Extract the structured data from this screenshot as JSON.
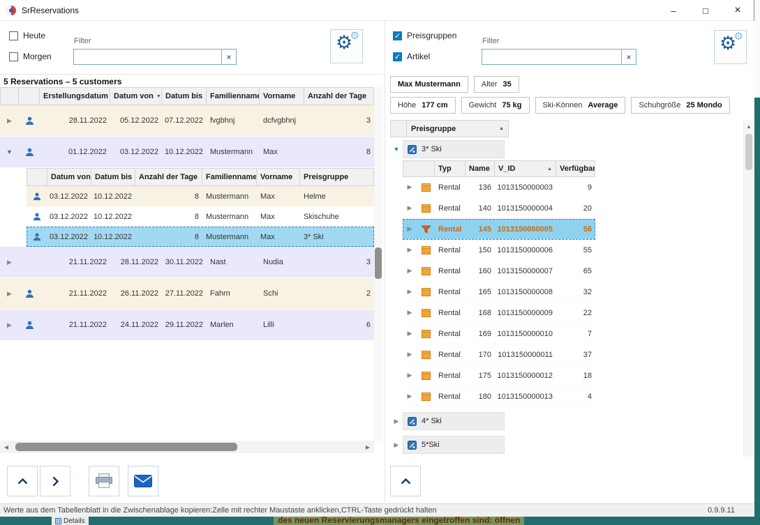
{
  "window": {
    "title": "SrReservations",
    "minimize": "–",
    "maximize": "□",
    "close": "×"
  },
  "icons": {
    "gear": "⚙",
    "clear": "×",
    "sort_up": "▲",
    "sort_down": "▼",
    "collapsed": "▶",
    "expanded": "▼",
    "scroll_left": "◀",
    "scroll_right": "▶",
    "scroll_up": "▲"
  },
  "left": {
    "today_label": "Heute",
    "tomorrow_label": "Morgen",
    "filter_label": "Filter",
    "filter_value": "",
    "summary": "5 Reservations – 5 customers",
    "columns": [
      "Erstellungsdatum",
      "Datum von",
      "Datum bis",
      "Familienname",
      "Vorname",
      "Anzahl der Tage"
    ],
    "rows": [
      {
        "erst": "28.11.2022",
        "von": "05.12.2022",
        "bis": "07.12.2022",
        "fam": "fvgbhnj",
        "vor": "dcfvgbhnj",
        "tage": "3"
      },
      {
        "erst": "01.12.2022",
        "von": "03.12.2022",
        "bis": "10.12.2022",
        "fam": "Mustermann",
        "vor": "Max",
        "tage": "8"
      },
      {
        "erst": "21.11.2022",
        "von": "28.11.2022",
        "bis": "30.11.2022",
        "fam": "Nast",
        "vor": "Nudia",
        "tage": "3"
      },
      {
        "erst": "21.11.2022",
        "von": "26.11.2022",
        "bis": "27.11.2022",
        "fam": "Fahrn",
        "vor": "Schi",
        "tage": "2"
      },
      {
        "erst": "21.11.2022",
        "von": "24.11.2022",
        "bis": "29.11.2022",
        "fam": "Marlen",
        "vor": "Lilli",
        "tage": "6"
      }
    ],
    "sub": {
      "columns": [
        "Datum von",
        "Datum bis",
        "Anzahl der Tage",
        "Familienname",
        "Vorname",
        "Preisgruppe"
      ],
      "rows": [
        {
          "von": "03.12.2022",
          "bis": "10.12.2022",
          "tage": "8",
          "fam": "Mustermann",
          "vor": "Max",
          "gruppe": "Helme"
        },
        {
          "von": "03.12.2022",
          "bis": "10.12.2022",
          "tage": "8",
          "fam": "Mustermann",
          "vor": "Max",
          "gruppe": "Skischuhe"
        },
        {
          "von": "03.12.2022",
          "bis": "10.12.2022",
          "tage": "8",
          "fam": "Mustermann",
          "vor": "Max",
          "gruppe": "3* Ski"
        }
      ]
    }
  },
  "right": {
    "preisgruppen_label": "Preisgruppen",
    "artikel_label": "Artikel",
    "filter_label": "Filter",
    "filter_value": "",
    "customer": {
      "name": "Max Mustermann",
      "alter_label": "Alter",
      "alter": "35",
      "hoehe_label": "Höhe",
      "hoehe": "177 cm",
      "gewicht_label": "Gewicht",
      "gewicht": "75 kg",
      "ski_label": "Ski-Können",
      "ski": "Average",
      "schuh_label": "Schuhgröße",
      "schuh": "25 Mondo"
    },
    "tree": {
      "group_column": "Preisgruppe",
      "columns": [
        "Typ",
        "Name",
        "V_ID",
        "Verfügbar"
      ],
      "groups": [
        {
          "label": "3* Ski"
        },
        {
          "label": "4* Ski"
        },
        {
          "label": "5*Ski"
        }
      ],
      "items": [
        {
          "typ": "Rental",
          "name": "136",
          "vid": "1013150000003",
          "verf": "9"
        },
        {
          "typ": "Rental",
          "name": "140",
          "vid": "1013150000004",
          "verf": "20"
        },
        {
          "typ": "Rental",
          "name": "145",
          "vid": "1013150000005",
          "verf": "56"
        },
        {
          "typ": "Rental",
          "name": "150",
          "vid": "1013150000006",
          "verf": "55"
        },
        {
          "typ": "Rental",
          "name": "160",
          "vid": "1013150000007",
          "verf": "65"
        },
        {
          "typ": "Rental",
          "name": "165",
          "vid": "1013150000008",
          "verf": "32"
        },
        {
          "typ": "Rental",
          "name": "168",
          "vid": "1013150000009",
          "verf": "22"
        },
        {
          "typ": "Rental",
          "name": "169",
          "vid": "1013150000010",
          "verf": "7"
        },
        {
          "typ": "Rental",
          "name": "170",
          "vid": "1013150000011",
          "verf": "37"
        },
        {
          "typ": "Rental",
          "name": "175",
          "vid": "1013150000012",
          "verf": "18"
        },
        {
          "typ": "Rental",
          "name": "180",
          "vid": "1013150000013",
          "verf": "4"
        }
      ]
    }
  },
  "statusbar": {
    "text": "Werte aus dem Tabellenblatt in die Zwischenablage kopieren:Zelle mit rechter Maustaste anklicken,CTRL-Taste gedrückt halten",
    "version": "0.9.9.11"
  },
  "background": {
    "details": "Details",
    "text": "des neuen Reservierungsmanagers eingetroffen sind: öffnen"
  }
}
